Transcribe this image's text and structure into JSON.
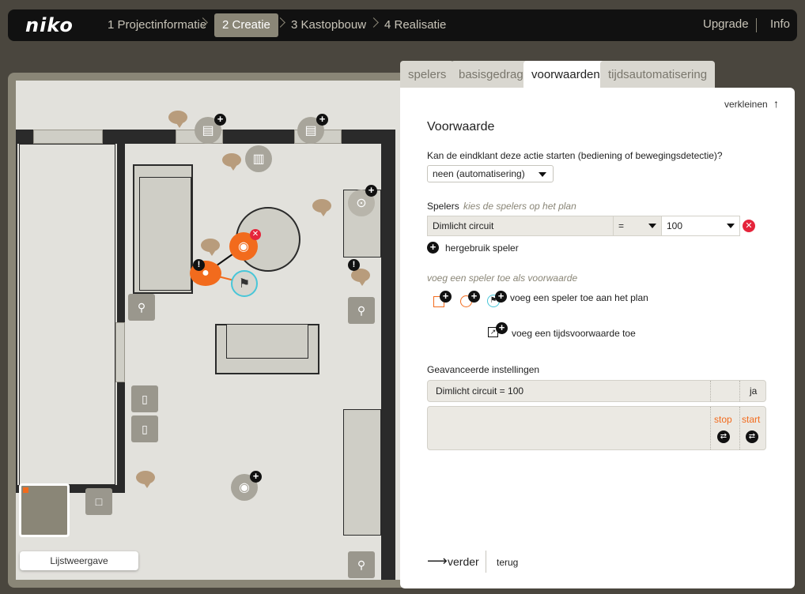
{
  "brand": {
    "logo": "niko"
  },
  "nav": {
    "steps": [
      "1 Projectinformatie",
      "2 Creatie",
      "3 Kastopbouw",
      "4 Realisatie"
    ],
    "active_step": 1,
    "upgrade": "Upgrade",
    "info": "Info"
  },
  "plan": {
    "list_view_button": "Lijstweergave"
  },
  "tabs": [
    "spelers",
    "basisgedrag",
    "voorwaarden",
    "tijdsautomatisering"
  ],
  "active_tab": 2,
  "panel": {
    "minimize": "verkleinen",
    "title": "Voorwaarde",
    "question": "Kan de eindklant deze actie starten (bediening of bewegingsdetectie)?",
    "trigger_select": "neen (automatisering)",
    "players_label": "Spelers",
    "players_hint": "kies de spelers op het plan",
    "condition": {
      "player": "Dimlicht circuit",
      "operator": "=",
      "value": "100"
    },
    "reuse_player": "hergebruik speler",
    "add_condition_hint": "voeg een speler toe als voorwaarde",
    "add_player_to_plan": "voeg een speler toe aan het plan",
    "add_time_condition": "voeg een tijdsvoorwaarde toe",
    "advanced_title": "Geavanceerde instellingen",
    "advanced_row": {
      "text": "Dimlicht circuit = 100",
      "state": "ja"
    },
    "stop_label": "stop",
    "start_label": "start",
    "next": "verder",
    "back": "terug"
  },
  "colors": {
    "accent": "#f26b1d",
    "nav_active": "#8a8677",
    "danger": "#e5243b"
  }
}
